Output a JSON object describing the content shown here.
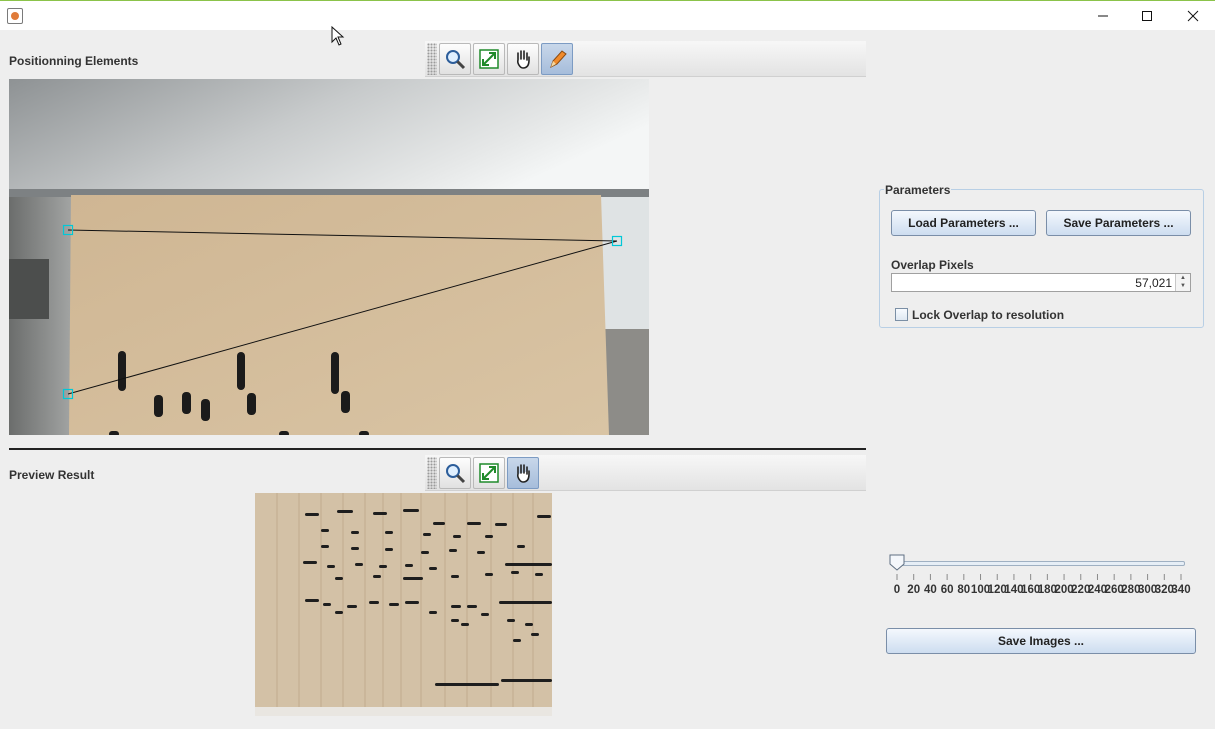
{
  "window": {
    "title": ""
  },
  "positioning": {
    "title": "Positionning Elements",
    "tools": [
      "zoom-icon",
      "fit-icon",
      "pan-icon",
      "edit-icon"
    ],
    "active_tool": "edit-icon"
  },
  "preview": {
    "title": "Preview Result",
    "tools": [
      "zoom-icon",
      "fit-icon",
      "pan-icon"
    ],
    "active_tool": "pan-icon"
  },
  "parameters": {
    "legend": "Parameters",
    "load_label": "Load Parameters ...",
    "save_label": "Save Parameters ...",
    "overlap_label": "Overlap Pixels",
    "overlap_value": "57,021",
    "lock_label": "Lock Overlap to resolution",
    "lock_checked": false
  },
  "slider": {
    "value": 0,
    "min": 0,
    "max": 340,
    "tick_labels": [
      "0",
      "20",
      "40",
      "60",
      "80",
      "100",
      "120",
      "140",
      "160",
      "180",
      "200",
      "220",
      "240",
      "260",
      "280",
      "300",
      "320",
      "340"
    ]
  },
  "save_images_label": "Save Images ...",
  "colors": {
    "accent_active": "#a6bddb",
    "handle": "#00c8d8",
    "button_top": "#f4f8fd",
    "button_bottom": "#cdddf0"
  }
}
